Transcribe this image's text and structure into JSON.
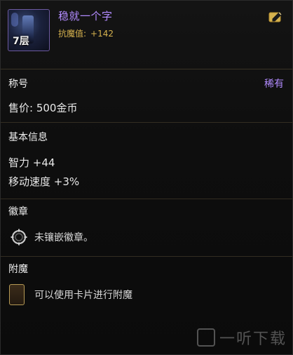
{
  "item": {
    "name": "稳就一个字",
    "level_badge": "7层",
    "resist_label": "抗魔值:",
    "resist_value": "+142"
  },
  "sections": {
    "title_header": "称号",
    "rarity": "稀有",
    "price": "售价: 500金币",
    "basic_header": "基本信息",
    "stats": [
      "智力 +44",
      "移动速度 +3%"
    ],
    "emblem_header": "徽章",
    "emblem_text": "未镶嵌徽章。",
    "enchant_header": "附魔",
    "enchant_text": "可以使用卡片进行附魔"
  },
  "icons": {
    "edit": "edit-icon",
    "emblem": "emblem-slot-icon",
    "card": "card-slot-icon"
  },
  "colors": {
    "accent_purple": "#b28bff",
    "accent_gold": "#d6b24e",
    "divider": "#332d22"
  },
  "watermark": {
    "text": "一听下载"
  }
}
